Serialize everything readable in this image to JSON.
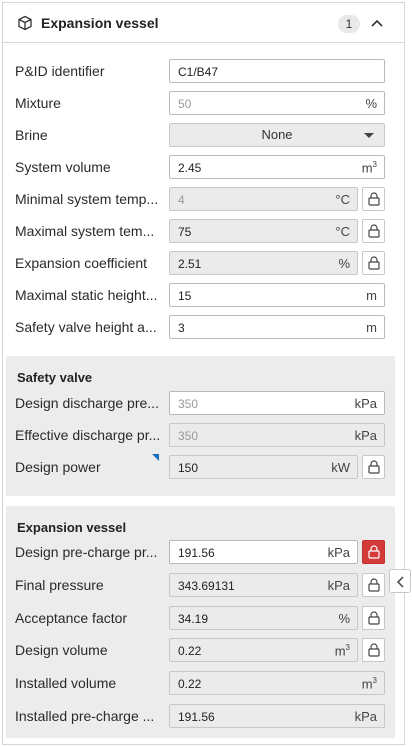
{
  "header": {
    "title": "Expansion vessel",
    "badge": "1"
  },
  "general": {
    "pid": {
      "label": "P&ID identifier",
      "value": "C1/B47"
    },
    "mixture": {
      "label": "Mixture",
      "value": "50",
      "unit": "%"
    },
    "brine": {
      "label": "Brine",
      "value": "None"
    },
    "system_volume": {
      "label": "System volume",
      "value": "2.45",
      "unit": "m",
      "unit_sup": "3"
    },
    "min_temp": {
      "label": "Minimal system temp...",
      "value": "4",
      "unit": "°C"
    },
    "max_temp": {
      "label": "Maximal system tem...",
      "value": "75",
      "unit": "°C"
    },
    "exp_coeff": {
      "label": "Expansion coefficient",
      "value": "2.51",
      "unit": "%"
    },
    "max_static": {
      "label": "Maximal static height...",
      "value": "15",
      "unit": "m"
    },
    "safety_height": {
      "label": "Safety valve height a...",
      "value": "3",
      "unit": "m"
    }
  },
  "safety_valve": {
    "title": "Safety valve",
    "design_discharge": {
      "label": "Design discharge pre...",
      "value": "350",
      "unit": "kPa"
    },
    "effective_discharge": {
      "label": "Effective discharge pr...",
      "value": "350",
      "unit": "kPa"
    },
    "design_power": {
      "label": "Design power",
      "value": "150",
      "unit": "kW"
    }
  },
  "vessel": {
    "title": "Expansion vessel",
    "pre_charge": {
      "label": "Design pre-charge pr...",
      "value": "191.56",
      "unit": "kPa"
    },
    "final_pressure": {
      "label": "Final pressure",
      "value": "343.69131",
      "unit": "kPa"
    },
    "acceptance": {
      "label": "Acceptance factor",
      "value": "34.19",
      "unit": "%"
    },
    "design_volume": {
      "label": "Design volume",
      "value": "0.22",
      "unit": "m",
      "unit_sup": "3"
    },
    "installed_volume": {
      "label": "Installed volume",
      "value": "0.22",
      "unit": "m",
      "unit_sup": "3"
    },
    "installed_pre_charge": {
      "label": "Installed pre-charge ...",
      "value": "191.56",
      "unit": "kPa"
    }
  },
  "colors": {
    "lock_active": "#d33b3b",
    "readonly_bg": "#ebebeb",
    "section_bg": "#ececec",
    "marker": "#1b6ec2"
  }
}
